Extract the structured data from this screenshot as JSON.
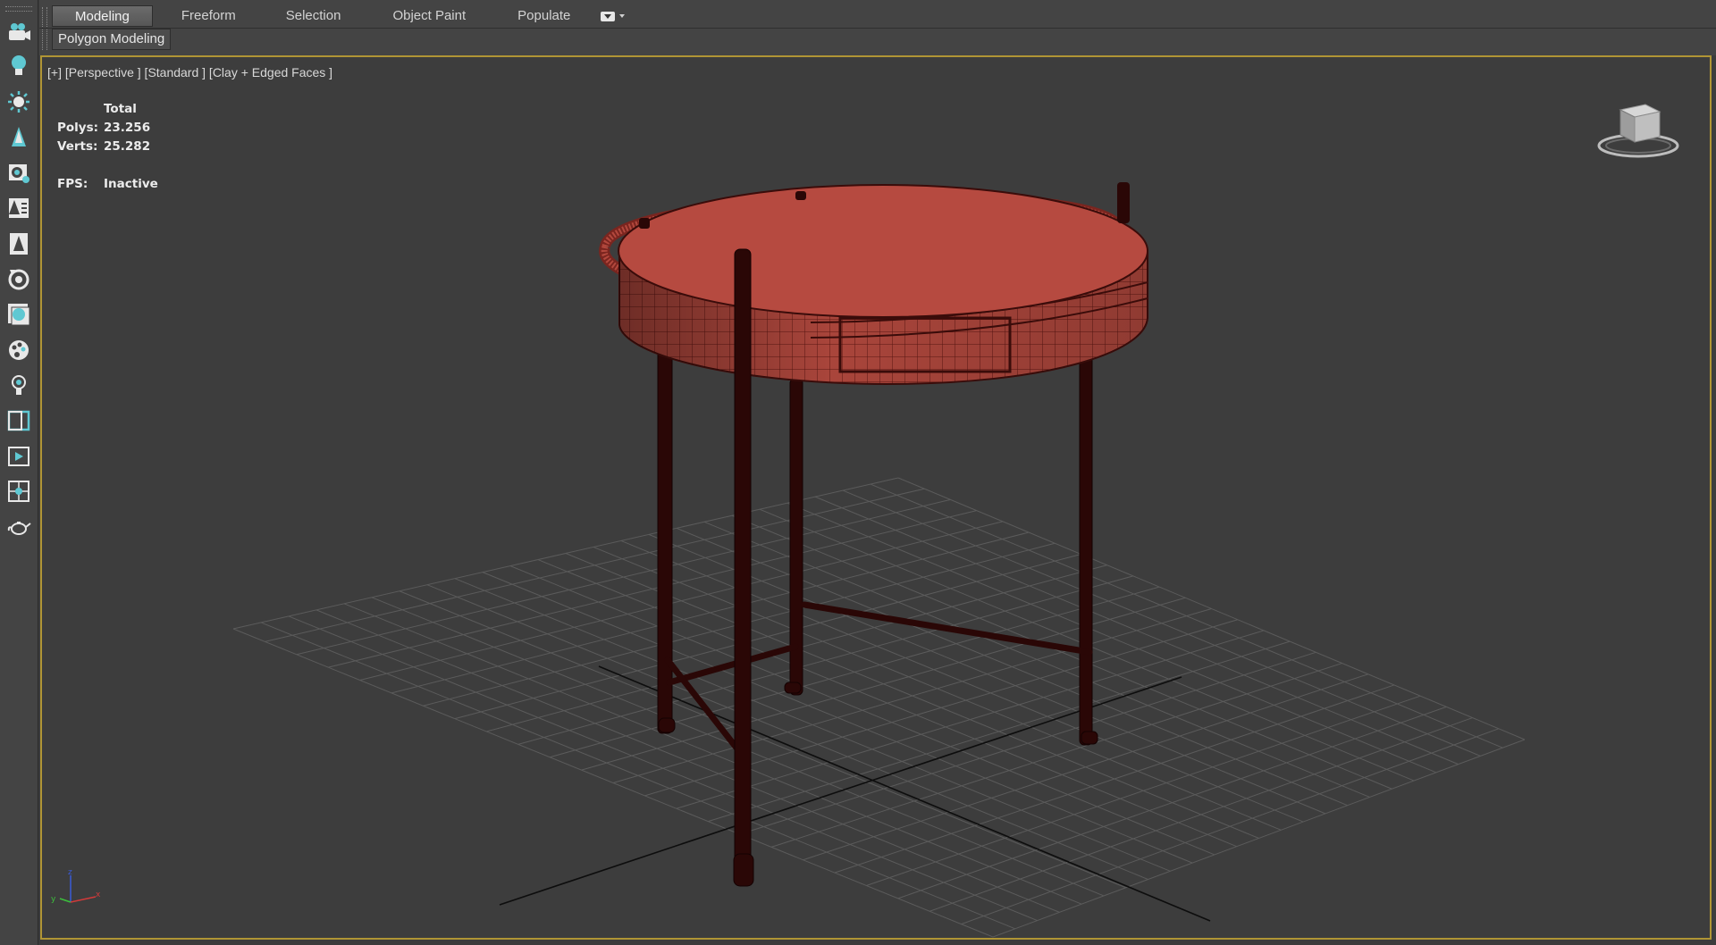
{
  "ribbon": {
    "tabs": [
      "Modeling",
      "Freeform",
      "Selection",
      "Object Paint",
      "Populate"
    ],
    "active_tab": "Modeling",
    "panel_button": "Polygon Modeling"
  },
  "left_toolbar": {
    "icons": [
      "camera-icon",
      "light-bulb-icon",
      "sun-icon",
      "tree-icon",
      "view-camera-icon",
      "foliage-icon",
      "pine-tree-icon",
      "turntable-icon",
      "material-icon",
      "paint-palette-icon",
      "light-icon",
      "viewport-layout-icon",
      "render-frame-icon",
      "snap-icon",
      "teapot-icon"
    ]
  },
  "viewport": {
    "label": "[+] [Perspective ] [Standard ] [Clay + Edged Faces ]",
    "stats": {
      "header": "Total",
      "polys_label": "Polys:",
      "polys_value": "23.256",
      "verts_label": "Verts:",
      "verts_value": "25.282",
      "fps_label": "FPS:",
      "fps_value": "Inactive"
    },
    "axis": {
      "x": "x",
      "y": "y",
      "z": "z"
    },
    "colors": {
      "border_active": "#b09535",
      "model_face": "#b64a40",
      "model_edge": "#3a0c0a",
      "legs": "#2a0706",
      "grid": "#5c5c5c"
    }
  }
}
